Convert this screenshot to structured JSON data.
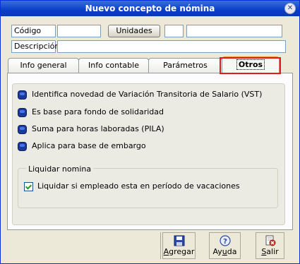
{
  "window": {
    "title": "Nuevo concepto de nómina"
  },
  "header": {
    "codigo_label": "Código",
    "codigo_value": "",
    "unidades_button": "Unidades",
    "unidades_value": "",
    "unidades_desc_value": "",
    "descripcion_label": "Descripción",
    "descripcion_value": ""
  },
  "tabs": [
    {
      "label": "Info general",
      "active": false
    },
    {
      "label": "Info contable",
      "active": false
    },
    {
      "label": "Parámetros",
      "active": false
    },
    {
      "label": "Otros",
      "active": true
    }
  ],
  "options": [
    {
      "label": "Identifica novedad de Variación Transitoria de Salario (VST)"
    },
    {
      "label": "Es base para fondo de solidaridad"
    },
    {
      "label": "Suma para horas laboradas (PILA)"
    },
    {
      "label": "Aplica para base de embargo"
    }
  ],
  "liquidar": {
    "legend": "Liquidar nomina",
    "checkbox_label": "Liquidar si empleado esta en período de vacaciones",
    "checked": true
  },
  "footer": {
    "agregar": {
      "prefix": "",
      "hotkey": "A",
      "rest": "gregar",
      "icon": "save-icon"
    },
    "ayuda": {
      "prefix": "Ay",
      "hotkey": "u",
      "rest": "da",
      "icon": "help-icon"
    },
    "salir": {
      "prefix": "",
      "hotkey": "S",
      "rest": "alir",
      "icon": "exit-icon"
    }
  },
  "colors": {
    "titlebar": "#0a3ec9",
    "highlight_box": "#e21b1b",
    "tab_accent": "#e68b2c"
  }
}
